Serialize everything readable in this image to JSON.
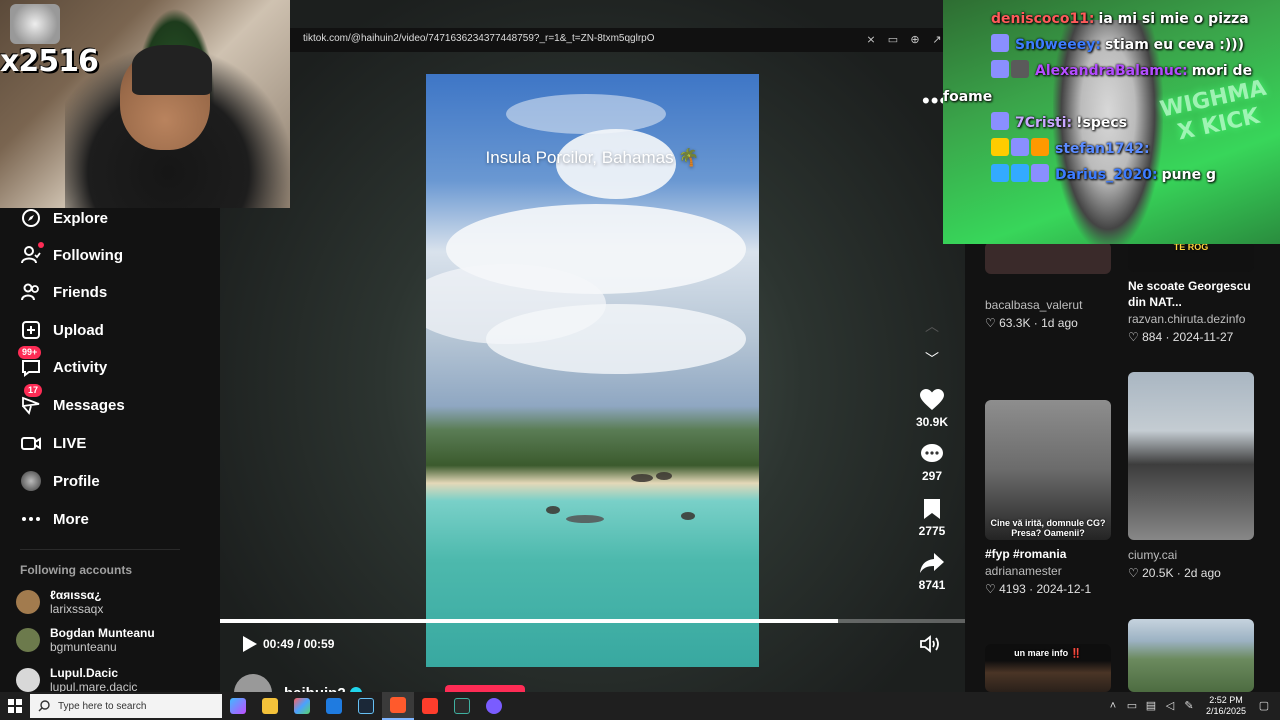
{
  "webcam": {
    "sub_count": "x2516"
  },
  "chat": [
    {
      "user": "deniscoco11:",
      "user_color": "#ff5a5a",
      "text": "ia mi si mie o pizza",
      "badges": []
    },
    {
      "user": "Sn0weeey:",
      "user_color": "#3d7cff",
      "text": "stiam eu ceva :)))",
      "badges": [
        "#8a8fff"
      ]
    },
    {
      "user": "AlexandraBalamuc:",
      "user_color": "#b44dff",
      "text": "mori de",
      "badges": [
        "#8a8fff",
        "#5a5a5a"
      ]
    },
    {
      "user": "",
      "user_color": "#ffffff",
      "text": "foame",
      "badges": []
    },
    {
      "user": "7Cristi:",
      "user_color": "#c9a8ff",
      "text": "!specs",
      "badges": [
        "#8a8fff"
      ]
    },
    {
      "user": "stefan1742:",
      "user_color": "#5b8cff",
      "text": "",
      "badges": [
        "#ffcc00",
        "#8a8fff",
        "#ff9900"
      ]
    },
    {
      "user": "Darius_2020:",
      "user_color": "#3d7cff",
      "text": "pune g",
      "badges": [
        "#33aaff",
        "#33aaff",
        "#8a8fff"
      ]
    }
  ],
  "overlay": {
    "neon_text": "WIGHMA X KICK"
  },
  "sidebar": {
    "items": [
      {
        "label": "Explore",
        "icon": "compass-icon",
        "badge": ""
      },
      {
        "label": "Following",
        "icon": "following-icon",
        "badge": "dot"
      },
      {
        "label": "Friends",
        "icon": "friends-icon",
        "badge": ""
      },
      {
        "label": "Upload",
        "icon": "upload-icon",
        "badge": ""
      },
      {
        "label": "Activity",
        "icon": "activity-icon",
        "badge": "99+"
      },
      {
        "label": "Messages",
        "icon": "messages-icon",
        "badge": "17"
      },
      {
        "label": "LIVE",
        "icon": "live-icon",
        "badge": ""
      },
      {
        "label": "Profile",
        "icon": "profile-icon",
        "badge": ""
      },
      {
        "label": "More",
        "icon": "more-icon",
        "badge": ""
      }
    ],
    "following_title": "Following accounts",
    "accounts": [
      {
        "name": "ℓαяιѕѕα¿",
        "handle": "larixssaqx",
        "color": "#a27b4e"
      },
      {
        "name": "Bogdan Munteanu",
        "handle": "bgmunteanu",
        "color": "#6c7a4c"
      },
      {
        "name": "Lupul.Dacic",
        "handle": "lupul.mare.dacic",
        "color": "#d8d8d8"
      }
    ]
  },
  "browser": {
    "url": "tiktok.com/@haihuin2/video/7471636234377448759?_r=1&_t=ZN-8txm5qglrpO"
  },
  "video": {
    "caption": "Insula Porcilor, Bahamas 🌴",
    "likes": "30.9K",
    "comments": "297",
    "saves": "2775",
    "shares": "8741",
    "time": "00:49 / 00:59",
    "progress": 0.83,
    "author": "haihuin2"
  },
  "feed": [
    {
      "caption": "",
      "user": "bacalbasa_valerut",
      "likes": "63.3K",
      "date": "1d ago",
      "thumb_text": "",
      "bg": "#3a2a2a"
    },
    {
      "caption": "Ne scoate Georgescu din NAT...",
      "user": "razvan.chiruta.dezinfo",
      "likes": "884",
      "date": "2024-11-27",
      "thumb_text": "TE ROG",
      "bg": "#111"
    },
    {
      "caption": "#fyp #romania",
      "user": "adrianamester",
      "likes": "4193",
      "date": "2024-12-1",
      "thumb_text": "Cine vă irită, domnule CG? Presa? Oamenii?",
      "bg": "#6d6d6d"
    },
    {
      "caption": "",
      "user": "ciumy.cai",
      "likes": "20.5K",
      "date": "2d ago",
      "thumb_text": "",
      "bg": "#9aa4ad"
    },
    {
      "caption": "",
      "user": "",
      "likes": "",
      "date": "",
      "thumb_text": "un mare info ‼️",
      "bg": "#2a201a"
    },
    {
      "caption": "",
      "user": "",
      "likes": "",
      "date": "",
      "thumb_text": "",
      "bg": "#6b8a5e"
    }
  ],
  "taskbar": {
    "search_placeholder": "Type here to search",
    "time": "2:52 PM",
    "date": "2/16/2025"
  }
}
